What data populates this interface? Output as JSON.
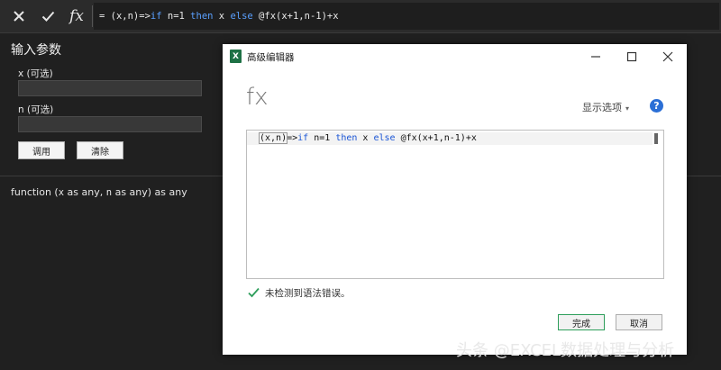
{
  "formula_bar": {
    "cancel_icon": "close-icon",
    "confirm_icon": "check-icon",
    "fx_label": "fx",
    "formula_parts": [
      {
        "text": "= (x,n)=>",
        "cls": ""
      },
      {
        "text": "if",
        "cls": "kw"
      },
      {
        "text": " n=1 ",
        "cls": ""
      },
      {
        "text": "then",
        "cls": "kw"
      },
      {
        "text": " x ",
        "cls": ""
      },
      {
        "text": "else",
        "cls": "kw"
      },
      {
        "text": " @fx(x+1,n-1)+x",
        "cls": ""
      }
    ]
  },
  "params_panel": {
    "title": "输入参数",
    "params": [
      {
        "label": "x (可选)",
        "value": ""
      },
      {
        "label": "n (可选)",
        "value": ""
      }
    ],
    "invoke_label": "调用",
    "clear_label": "清除",
    "signature_parts": {
      "prefix": "function (",
      "p1": "x",
      "mid1": " as any, ",
      "p2": "n",
      "suffix": " as any) as any"
    }
  },
  "dialog": {
    "title": "高级编辑器",
    "app_icon_letter": "X",
    "heading": "fx",
    "options_label": "显示选项",
    "help_label": "?",
    "code_parts": [
      {
        "text": "(x,n)",
        "cls": "paren"
      },
      {
        "text": "=>",
        "cls": ""
      },
      {
        "text": "if",
        "cls": "kw"
      },
      {
        "text": " n=1 ",
        "cls": ""
      },
      {
        "text": "then",
        "cls": "kw"
      },
      {
        "text": " x ",
        "cls": ""
      },
      {
        "text": "else",
        "cls": "kw"
      },
      {
        "text": " @fx(x+1,n-1)+x",
        "cls": ""
      }
    ],
    "status_text": "未检测到语法错误。",
    "done_label": "完成",
    "cancel_label": "取消"
  },
  "watermark": "头条 @EXCEL数据处理与分析",
  "colors": {
    "background": "#202020",
    "keyword_dark": "#5aa0ff",
    "keyword_light": "#1a55d6",
    "success": "#2e9e5b",
    "help_blue": "#2b6fd6"
  }
}
